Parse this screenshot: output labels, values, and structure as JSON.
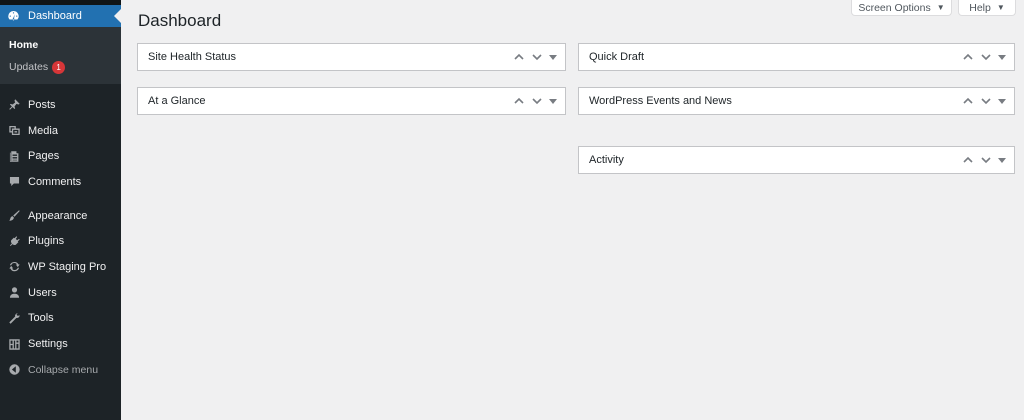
{
  "sidebar": {
    "dashboard": "Dashboard",
    "submenu": {
      "home": "Home",
      "updates": "Updates",
      "updates_count": "1"
    },
    "items": [
      {
        "label": "Posts",
        "icon": "pushpin-icon"
      },
      {
        "label": "Media",
        "icon": "media-icon"
      },
      {
        "label": "Pages",
        "icon": "pages-icon"
      },
      {
        "label": "Comments",
        "icon": "comment-icon"
      },
      {
        "label": "Appearance",
        "icon": "paintbrush-icon"
      },
      {
        "label": "Plugins",
        "icon": "plug-icon"
      },
      {
        "label": "WP Staging Pro",
        "icon": "sync-icon"
      },
      {
        "label": "Users",
        "icon": "user-icon"
      },
      {
        "label": "Tools",
        "icon": "wrench-icon"
      },
      {
        "label": "Settings",
        "icon": "settings-icon"
      }
    ],
    "collapse": "Collapse menu"
  },
  "header": {
    "screen_options": "Screen Options",
    "help": "Help"
  },
  "page_title": "Dashboard",
  "widgets": {
    "left": [
      {
        "title": "Site Health Status"
      },
      {
        "title": "At a Glance"
      }
    ],
    "right": [
      {
        "title": "Quick Draft"
      },
      {
        "title": "WordPress Events and News"
      },
      {
        "title": "Activity"
      }
    ]
  },
  "colors": {
    "accent": "#2271b1",
    "sidebar_bg": "#1d2327",
    "badge": "#d63638"
  }
}
